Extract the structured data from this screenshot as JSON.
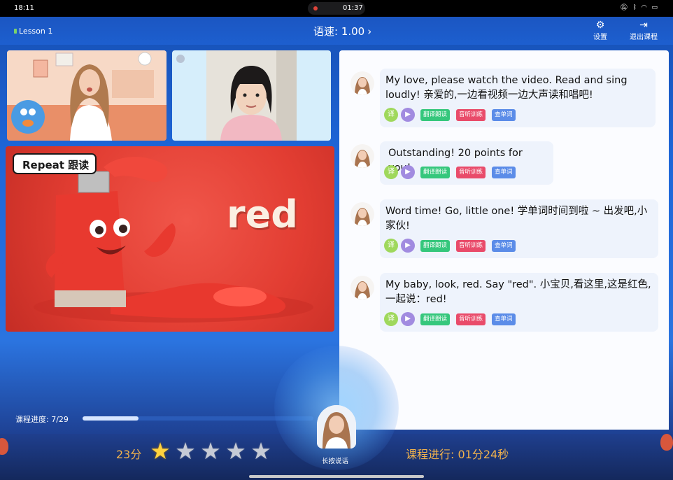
{
  "status_bar": {
    "time": "18:11",
    "recording_time": "01:37"
  },
  "header": {
    "lesson": "Lesson 1",
    "speed": "语速: 1.00",
    "settings_label": "设置",
    "exit_label": "退出课程"
  },
  "lesson_card": {
    "badge": "Repeat 跟读",
    "word": "red"
  },
  "chat": {
    "messages": [
      {
        "text": "My love, please watch the video. Read and sing loudly! 亲爱的,一边看视频一边大声读和唱吧!"
      },
      {
        "text": "Outstanding! 20 points for you!"
      },
      {
        "text": "Word time! Go, little one! 学单词时间到啦 ~ 出发吧,小家伙!"
      },
      {
        "text": "My baby, look, red. Say \"red\". 小宝贝,看这里,这是红色,一起说：red!"
      }
    ],
    "actions": {
      "translate": "译",
      "read_aloud": "翻译朗读",
      "listening": "音听训练",
      "lookup": "查单词"
    }
  },
  "progress": {
    "label": "课程进度: 7/29",
    "current": 7,
    "total": 29
  },
  "footer": {
    "score": "23分",
    "stars_filled": 1,
    "stars_total": 5,
    "hold_to_talk": "长按说话",
    "elapsed": "课程进行: 01分24秒"
  },
  "colors": {
    "accent_blue": "#1e66d8",
    "score_orange": "#f3b34c",
    "chip_green": "#35c77c",
    "chip_red": "#e94b6a",
    "chip_blue": "#5b8ce8"
  }
}
